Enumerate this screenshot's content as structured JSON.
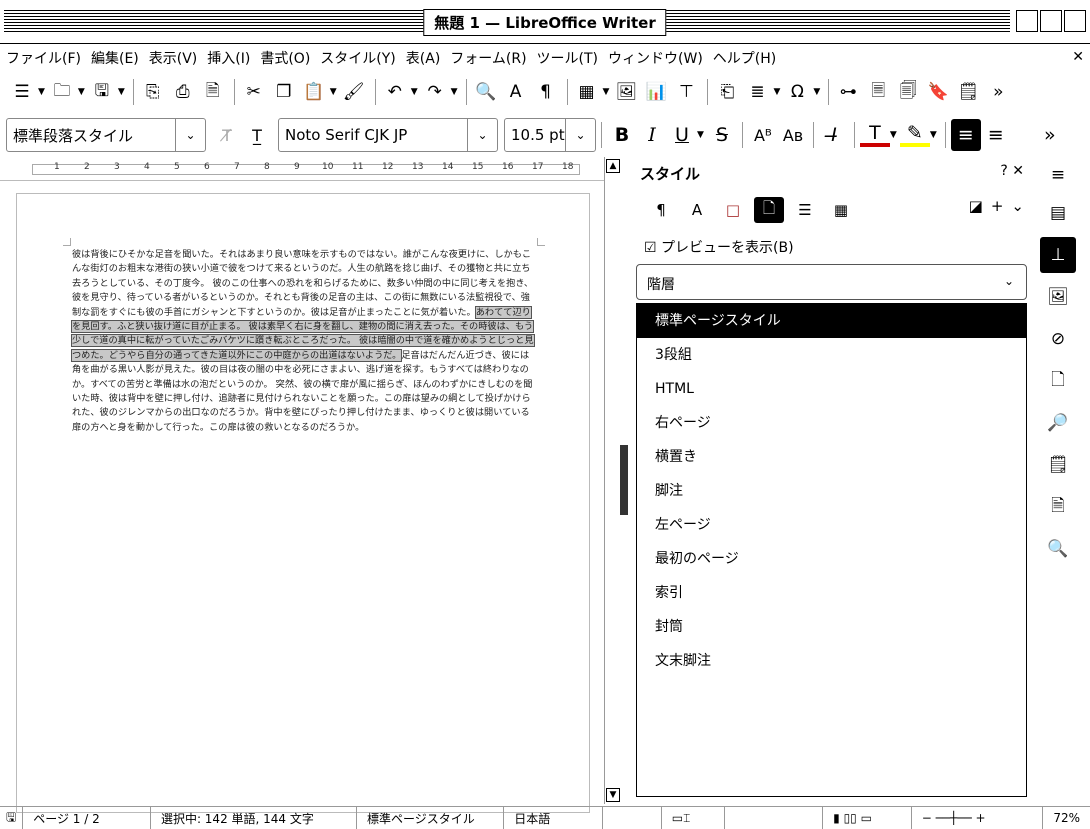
{
  "window": {
    "title": "無題 1 — LibreOffice Writer"
  },
  "menu": [
    "ファイル(F)",
    "編集(E)",
    "表示(V)",
    "挿入(I)",
    "書式(O)",
    "スタイル(Y)",
    "表(A)",
    "フォーム(R)",
    "ツール(T)",
    "ウィンドウ(W)",
    "ヘルプ(H)"
  ],
  "menu_close": "✕",
  "formatting": {
    "paragraph_style": "標準段落スタイル",
    "font_name": "Noto Serif CJK JP",
    "font_size": "10.5 pt"
  },
  "ruler": {
    "ticks": [
      "1",
      "2",
      "3",
      "4",
      "5",
      "6",
      "7",
      "8",
      "9",
      "10",
      "11",
      "12",
      "13",
      "14",
      "15",
      "16",
      "17",
      "18"
    ]
  },
  "document": {
    "before": "彼は背後にひそかな足音を聞いた。それはあまり良い意味を示すものではない。誰がこんな夜更けに、しかもこんな街灯のお粗末な港街の狭い小道で彼をつけて来るというのだ。人生の航路を捻じ曲げ、その獲物と共に立ち去ろうとしている、その丁度今。 彼のこの仕事への恐れを和らげるために、数多い仲間の中に同じ考えを抱き、彼を見守り、待っている者がいるというのか。それとも背後の足音の主は、この街に無数にいる法監視役で、強制な罰をすぐにも彼の手首にガシャンと下すというのか。彼は足音が止まったことに気が着いた。",
    "selected": "あわてて辺りを見回す。ふと狭い抜け道に目が止まる。 彼は素早く右に身を翻し、建物の間に消え去った。その時彼は、もう少しで道の真中に転がっていたごみバケツに躓き転ぶところだった。 彼は暗闇の中で道を確かめようとじっと見つめた。どうやら自分の通ってきた道以外にこの中庭からの出道はないようだ。",
    "after": "足音はだんだん近づき、彼には角を曲がる黒い人影が見えた。彼の目は夜の闇の中を必死にさまよい、逃げ道を探す。もうすべては終わりなのか。すべての苦労と準備は水の泡だというのか。 突然、彼の横で扉が風に揺らぎ、ほんのわずかにきしむのを聞いた時、彼は背中を壁に押し付け、追跡者に見付けられないことを願った。この扉は望みの綱として投げかけられた、彼のジレンマからの出口なのだろうか。背中を壁にぴったり押し付けたまま、ゆっくりと彼は開いている扉の方へと身を動かして行った。この扉は彼の救いとなるのだろうか。"
  },
  "sidebar": {
    "title": "スタイル",
    "help": "?",
    "close": "✕",
    "preview_label": "☑ プレビューを表示(B)",
    "filter": "階層",
    "styles": [
      "標準ページスタイル",
      "3段組",
      "HTML",
      "右ページ",
      "横置き",
      "脚注",
      "左ページ",
      "最初のページ",
      "索引",
      "封筒",
      "文末脚注"
    ]
  },
  "status": {
    "page": "ページ 1 / 2",
    "selection": "選択中: 142 単語, 144 文字",
    "page_style": "標準ページスタイル",
    "language": "日本語",
    "zoom": "72%"
  }
}
